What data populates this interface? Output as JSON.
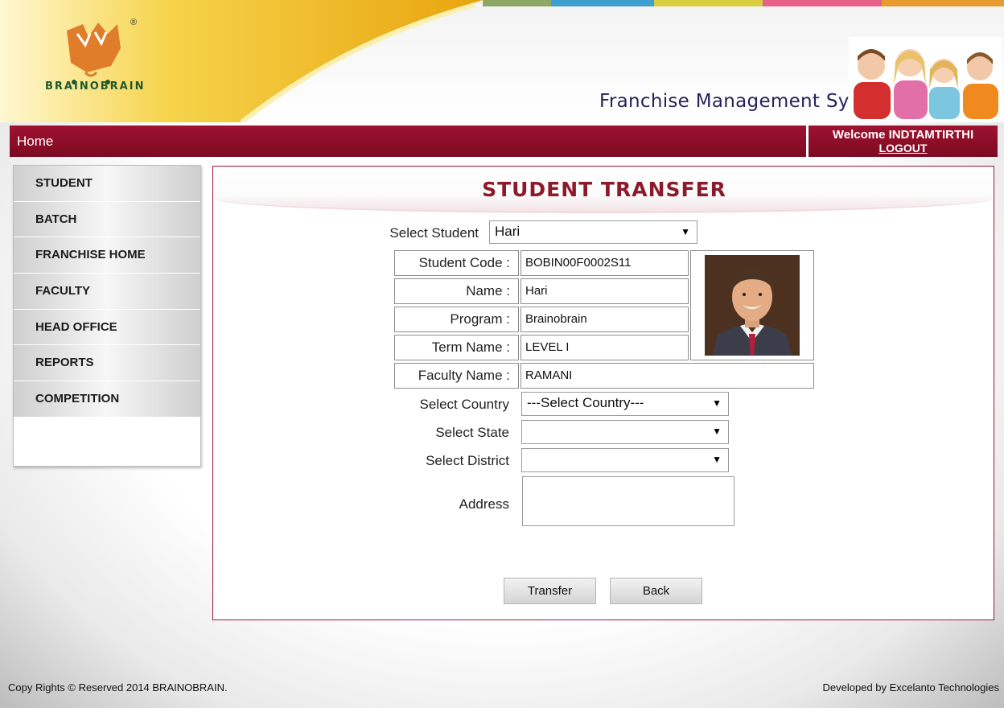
{
  "header": {
    "brand_name": "BRAINOBRAIN",
    "registered_mark": "®",
    "system_title": "Franchise Management System"
  },
  "nav": {
    "home_label": "Home",
    "welcome_text": "Welcome INDTAMTIRTHI",
    "logout_label": "LOGOUT"
  },
  "sidebar": {
    "items": [
      {
        "label": "STUDENT"
      },
      {
        "label": "BATCH"
      },
      {
        "label": "FRANCHISE HOME"
      },
      {
        "label": "FACULTY"
      },
      {
        "label": "HEAD OFFICE"
      },
      {
        "label": "REPORTS"
      },
      {
        "label": "COMPETITION"
      }
    ]
  },
  "main": {
    "title": "STUDENT TRANSFER",
    "select_student": {
      "label": "Select Student",
      "value": "Hari"
    },
    "info": [
      {
        "label": "Student Code :",
        "value": "BOBIN00F0002S11"
      },
      {
        "label": "Name :",
        "value": "Hari"
      },
      {
        "label": "Program :",
        "value": "Brainobrain"
      },
      {
        "label": "Term Name :",
        "value": "LEVEL I"
      },
      {
        "label": "Faculty Name :",
        "value": "RAMANI"
      }
    ],
    "select_country": {
      "label": "Select Country",
      "value": "---Select Country---"
    },
    "select_state": {
      "label": "Select State",
      "value": ""
    },
    "select_district": {
      "label": "Select District",
      "value": ""
    },
    "address": {
      "label": "Address",
      "value": ""
    },
    "buttons": {
      "transfer": "Transfer",
      "back": "Back"
    }
  },
  "footer": {
    "copyright": "Copy Rights © Reserved 2014 BRAINOBRAIN.",
    "developer": "Developed by Excelanto Technologies"
  },
  "colors": {
    "nav_red": "#8b0e28",
    "title_red": "#8d1a2b",
    "logo_orange": "#e07d2a",
    "brand_green": "#1e5a2e"
  },
  "icons": {
    "dropdown": "dropdown-arrow-icon",
    "logo": "brainobrain-logo-icon"
  }
}
